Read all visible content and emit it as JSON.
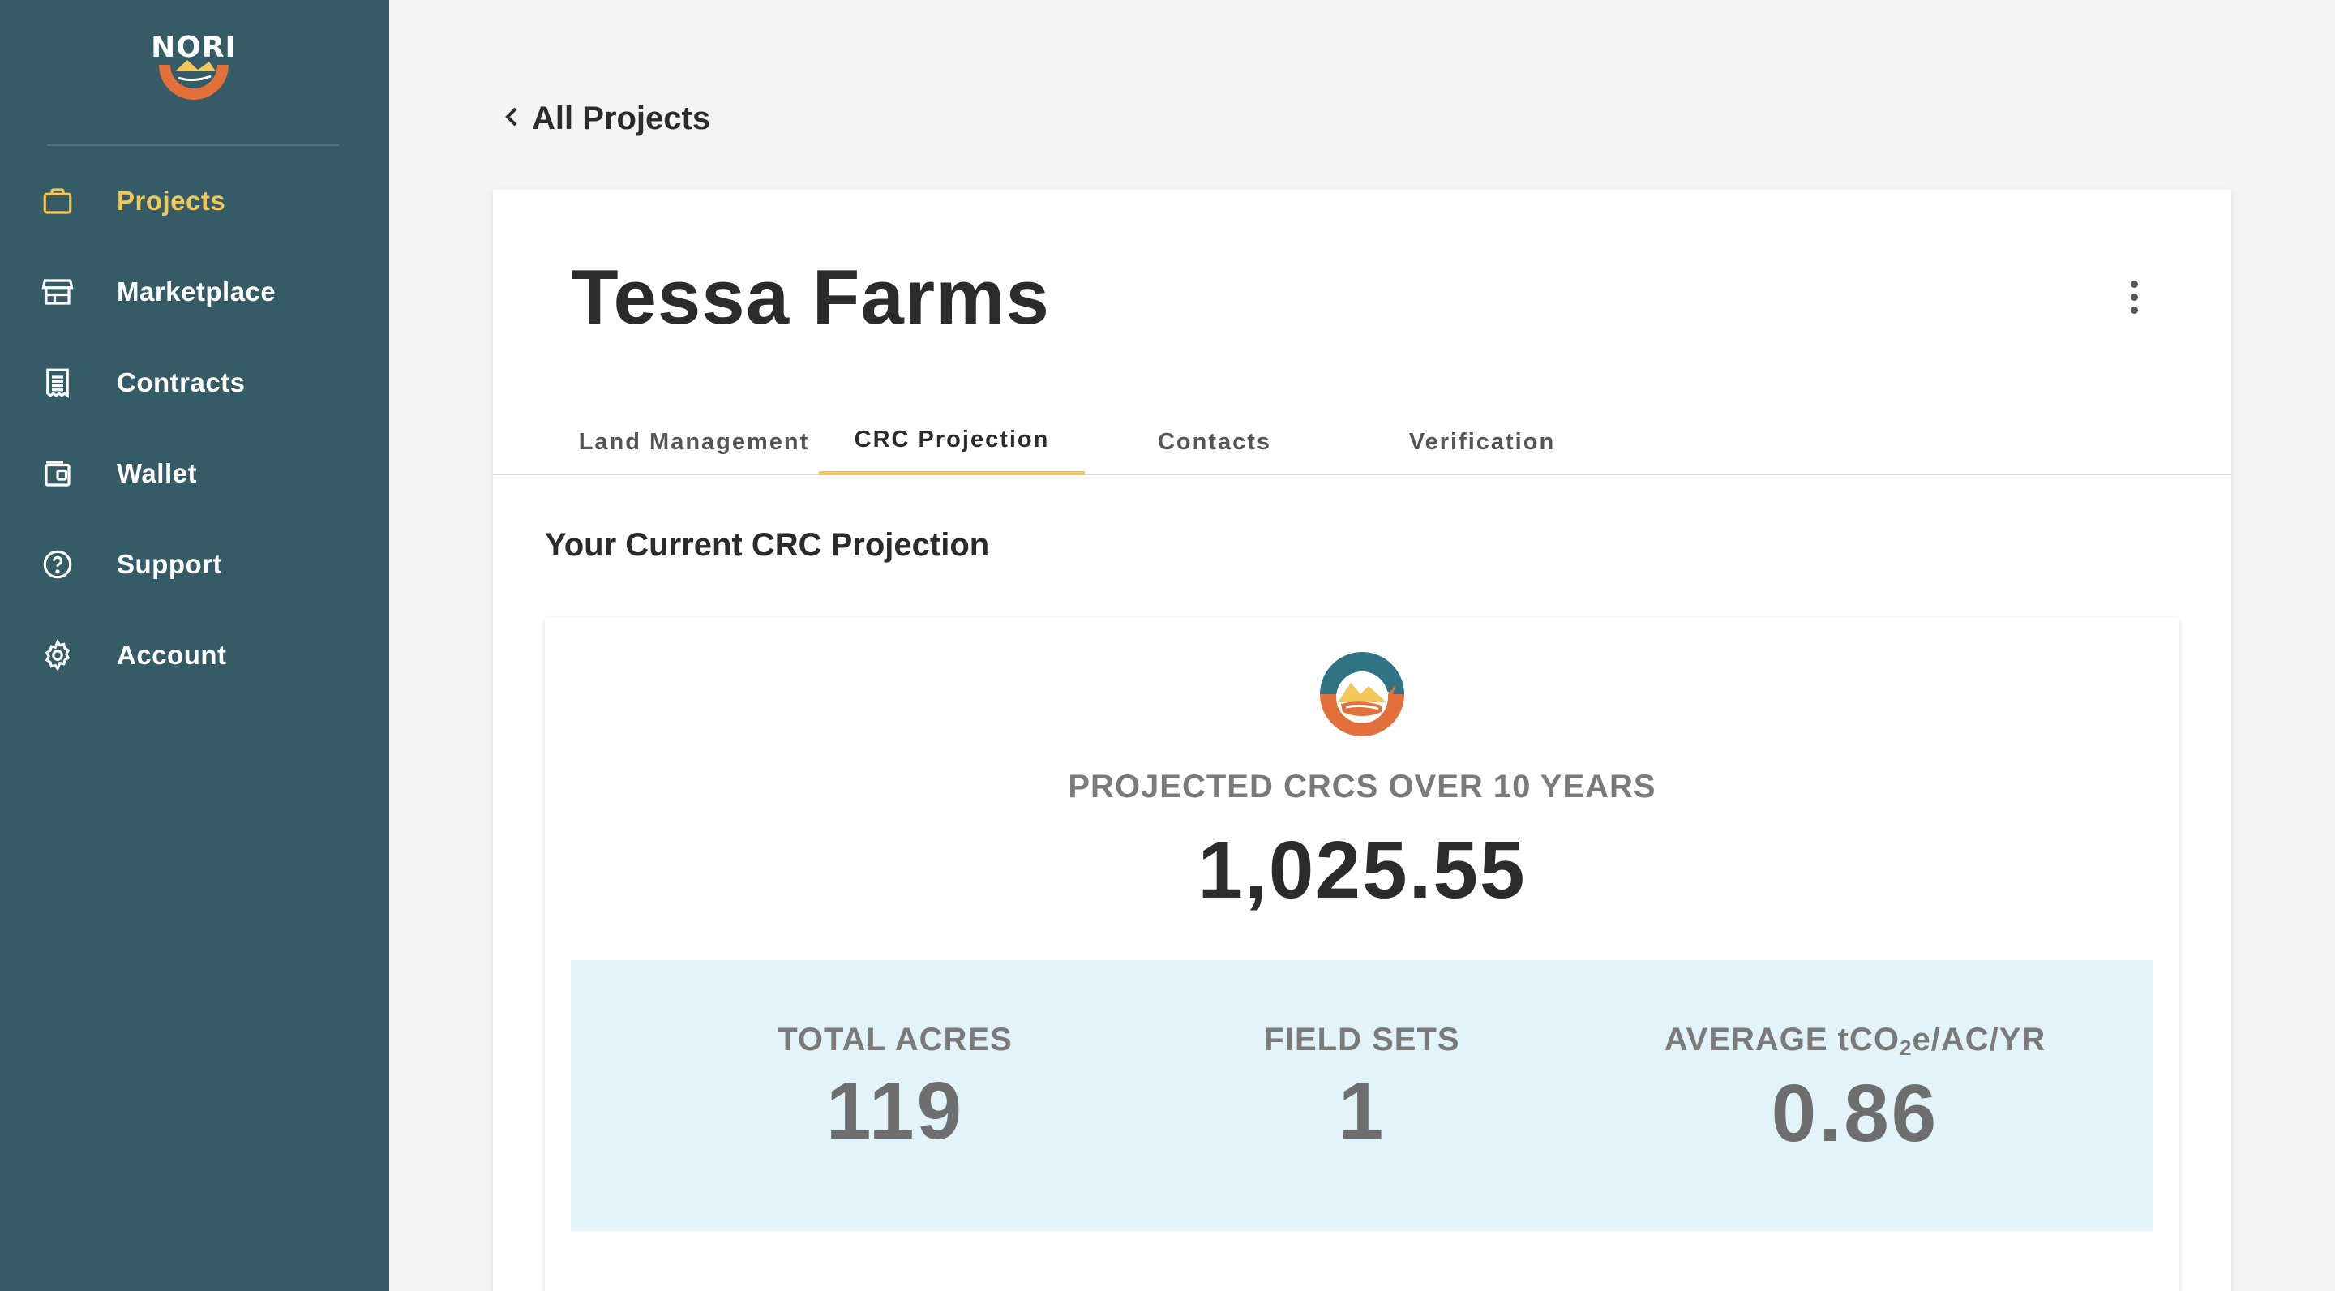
{
  "sidebar": {
    "logo_text": "NORI",
    "items": [
      {
        "label": "Projects",
        "icon": "briefcase-icon",
        "active": true
      },
      {
        "label": "Marketplace",
        "icon": "storefront-icon",
        "active": false
      },
      {
        "label": "Contracts",
        "icon": "receipt-icon",
        "active": false
      },
      {
        "label": "Wallet",
        "icon": "wallet-icon",
        "active": false
      },
      {
        "label": "Support",
        "icon": "help-circle-icon",
        "active": false
      },
      {
        "label": "Account",
        "icon": "gear-icon",
        "active": false
      }
    ]
  },
  "header": {
    "back_label": "All Projects",
    "project_title": "Tessa Farms"
  },
  "tabs": [
    {
      "label": "Land Management",
      "active": false
    },
    {
      "label": "CRC Projection",
      "active": true
    },
    {
      "label": "Contacts",
      "active": false
    },
    {
      "label": "Verification",
      "active": false
    }
  ],
  "projection": {
    "section_title": "Your Current CRC Projection",
    "label": "PROJECTED CRCS OVER 10 YEARS",
    "value": "1,025.55",
    "stats": {
      "total_acres": {
        "label": "TOTAL ACRES",
        "value": "119"
      },
      "field_sets": {
        "label": "FIELD SETS",
        "value": "1"
      },
      "average": {
        "label_prefix": "AVERAGE tCO",
        "label_sub": "2",
        "label_suffix": "e/AC/YR",
        "value": "0.86"
      }
    }
  },
  "colors": {
    "sidebar_bg": "#355c66",
    "active_nav": "#f2c75c",
    "tab_underline": "#f2c75c",
    "stats_band": "#e3f3fa",
    "logo_orange": "#e3703a",
    "logo_teal": "#2f7384"
  }
}
